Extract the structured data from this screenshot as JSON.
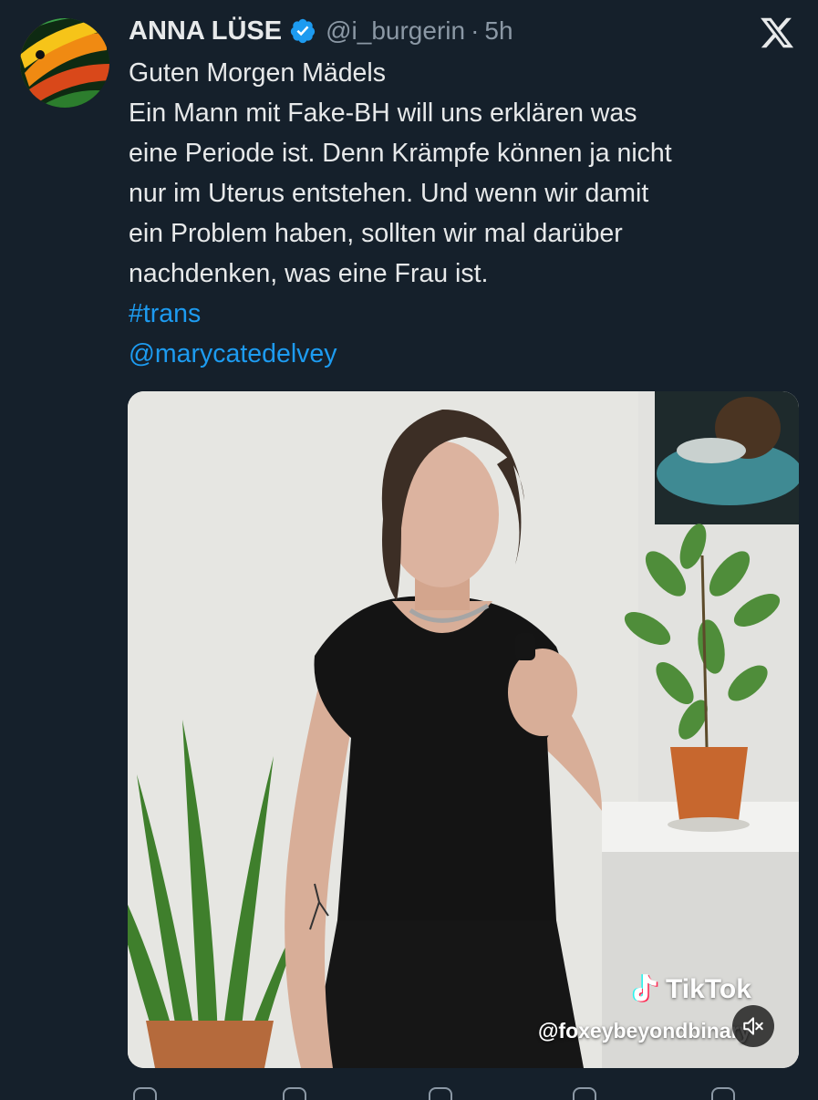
{
  "author": {
    "name": "ANNA LÜSE",
    "handle": "@i_burgerin",
    "separator": "·",
    "time": "5h",
    "verified": true
  },
  "tweet": {
    "lines": [
      "Guten Morgen Mädels",
      "Ein Mann mit Fake-BH will uns erklären was",
      "eine Periode ist. Denn Krämpfe können ja nicht",
      "nur im Uterus entstehen. Und wenn wir damit",
      "ein Problem haben, sollten wir mal darüber",
      "nachdenken, was eine Frau ist."
    ],
    "hashtag": "#trans",
    "mention": "@marycatedelvey"
  },
  "media": {
    "watermark_brand": "TikTok",
    "watermark_user": "@foxeybeyondbinary"
  },
  "colors": {
    "background": "#15202b",
    "text": "#e7e9ea",
    "secondary": "#8b98a5",
    "accent": "#1d9bf0"
  },
  "icons": {
    "close": "x-logo-icon",
    "verified": "verified-badge-icon",
    "mute": "speaker-muted-icon",
    "tiktok": "tiktok-note-icon"
  }
}
